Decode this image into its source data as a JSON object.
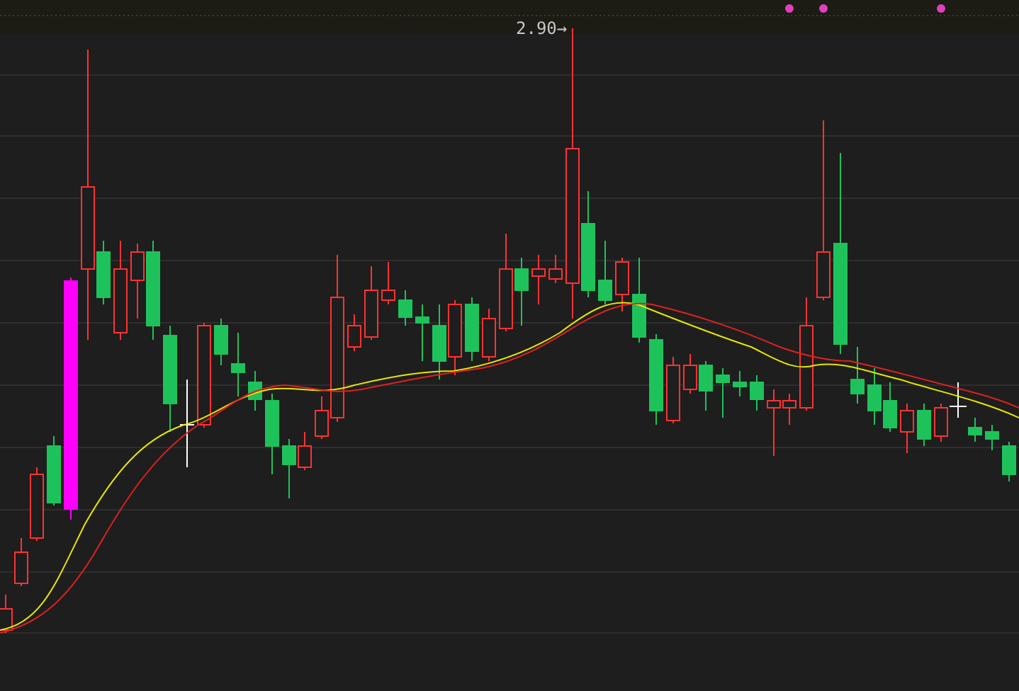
{
  "chart": {
    "price_marker": {
      "label": "2.90→"
    }
  }
}
